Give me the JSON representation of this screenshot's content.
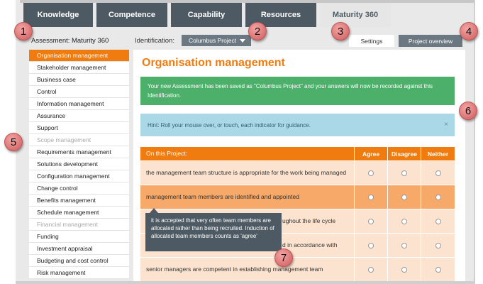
{
  "tabs": [
    {
      "label": "Knowledge"
    },
    {
      "label": "Competence"
    },
    {
      "label": "Capability"
    },
    {
      "label": "Resources"
    },
    {
      "label": "Maturity 360"
    }
  ],
  "header": {
    "assessment_label": "Assessment: Maturity 360",
    "identification_label": "Identification:",
    "identification_value": "Columbus Project",
    "settings_label": "Settings",
    "project_overview_label": "Project overview"
  },
  "sidebar": {
    "items": [
      {
        "label": "Organisation management"
      },
      {
        "label": "Stakeholder management"
      },
      {
        "label": "Business case"
      },
      {
        "label": "Control"
      },
      {
        "label": "Information management"
      },
      {
        "label": "Assurance"
      },
      {
        "label": "Support"
      },
      {
        "label": "Scope management"
      },
      {
        "label": "Requirements management"
      },
      {
        "label": "Solutions development"
      },
      {
        "label": "Configuration management"
      },
      {
        "label": "Change control"
      },
      {
        "label": "Benefits management"
      },
      {
        "label": "Schedule management"
      },
      {
        "label": "Financial management"
      },
      {
        "label": "Funding"
      },
      {
        "label": "Investment appraisal"
      },
      {
        "label": "Budgeting and cost control"
      },
      {
        "label": "Risk management"
      }
    ]
  },
  "main": {
    "title": "Organisation management",
    "success_message": "Your new Assessment has been saved as \"Columbus Project\" and your answers will now be recorded against this Identification.",
    "hint_message": "Hint: Roll your mouse over, or touch, each indicator for guidance.",
    "hint_close": "×",
    "table": {
      "headers": [
        "On this Project:",
        "Agree",
        "Disagree",
        "Neither"
      ],
      "rows": [
        {
          "text": "the management team structure is appropriate for the work being managed"
        },
        {
          "text": "management team members are identified and appointed"
        },
        {
          "text": "ughout the life cycle"
        },
        {
          "text": "d in accordance with"
        },
        {
          "text": "senior managers are competent in establishing management team"
        }
      ]
    },
    "tooltip": "it is accepted that very often team members are allocated rather than being recruited. Induction of allocated team members counts as 'agree'"
  },
  "callouts": [
    "1",
    "2",
    "3",
    "4",
    "5",
    "6",
    "7"
  ],
  "colors": {
    "accent": "#f07b0f",
    "tab": "#4d5a63",
    "success": "#4caf6a",
    "info": "#abd8e6",
    "row": "#fce3cf",
    "row_highlight": "#f6a968"
  }
}
